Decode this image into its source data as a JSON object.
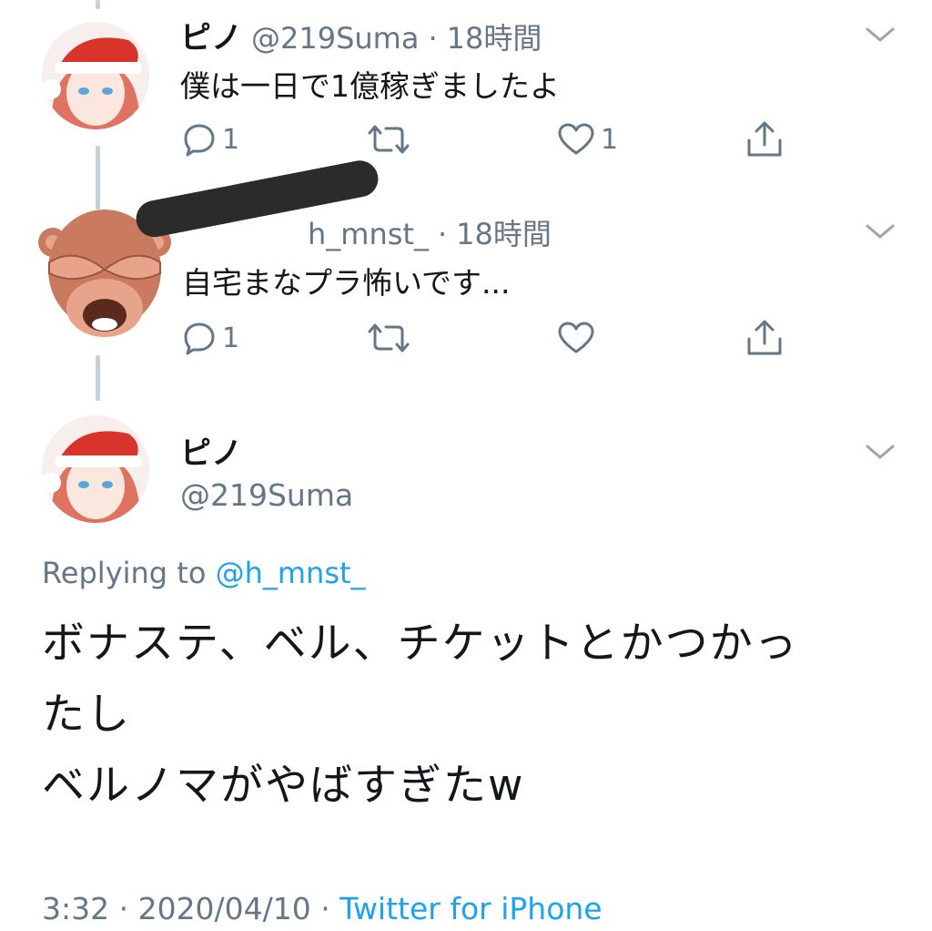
{
  "tweets": [
    {
      "name": "ピノ",
      "handle": "@219Suma",
      "time": "18時間",
      "text": "僕は一日で1億稼ぎましたよ",
      "reply_count": "1",
      "like_count": "1"
    },
    {
      "name": "",
      "handle": "h_mnst_",
      "time": "18時間",
      "text": "自宅まなプラ怖いです...",
      "reply_count": "1",
      "like_count": ""
    }
  ],
  "main": {
    "name": "ピノ",
    "handle": "@219Suma",
    "replying_prefix": "Replying to",
    "replying_handle": "@h_mnst_",
    "text_line1": "ボナステ、ベル、チケットとかつかっ",
    "text_line2": "たし",
    "text_line3": "ベルノマがやばすぎたw",
    "time": "3:32 · 2020/04/10 · ",
    "source": "Twitter for iPhone"
  },
  "separator": "·",
  "icons": {
    "reply": "reply-icon",
    "retweet": "retweet-icon",
    "like": "heart-icon",
    "share": "share-icon",
    "more": "chevron-down-icon",
    "sticker": "see-no-evil-monkey-sticker"
  },
  "colors": {
    "secondary": "#657786",
    "link": "#1da1f2",
    "thread_line": "#c8d0d7",
    "redaction": "#2b2b2b"
  }
}
